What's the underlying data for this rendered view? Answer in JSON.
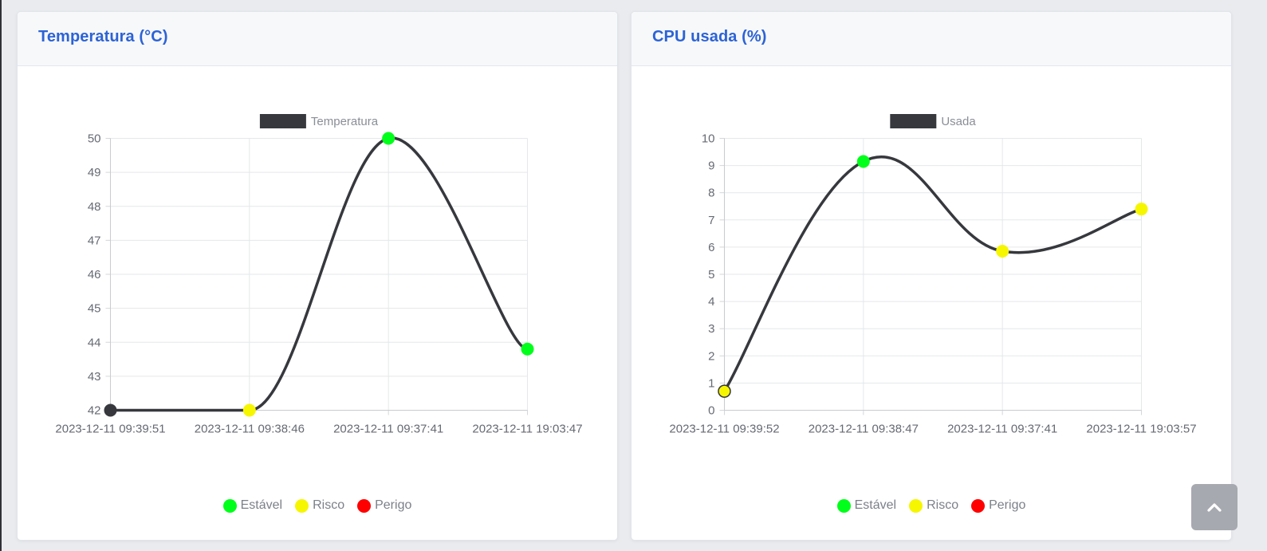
{
  "cards": [
    {
      "title": "Temperatura (°C)"
    },
    {
      "title": "CPU usada (%)"
    }
  ],
  "status_legend": [
    {
      "label": "Estável",
      "color": "#00ff1a"
    },
    {
      "label": "Risco",
      "color": "#f6f600"
    },
    {
      "label": "Perigo",
      "color": "#ff0000"
    }
  ],
  "back_to_top": {
    "icon": "chevron-up-icon"
  },
  "colors": {
    "line": "#36383d",
    "title": "#2c63d6"
  },
  "chart_data": [
    {
      "type": "line",
      "title": "Temperatura (°C)",
      "categories": [
        "2023-12-11 09:39:51",
        "2023-12-11 09:38:46",
        "2023-12-11 09:37:41",
        "2023-12-11 19:03:47"
      ],
      "series": [
        {
          "name": "Temperatura",
          "values": [
            42,
            42,
            50,
            43.8
          ],
          "point_colors": [
            "#36383d",
            "#f6f600",
            "#00ff1a",
            "#00ff1a"
          ]
        }
      ],
      "ylim": [
        42,
        50
      ],
      "yticks": [
        42,
        43,
        44,
        45,
        46,
        47,
        48,
        49,
        50
      ],
      "grid": true,
      "legend": "top-center",
      "curved": false
    },
    {
      "type": "line",
      "title": "CPU usada (%)",
      "categories": [
        "2023-12-11 09:39:52",
        "2023-12-11 09:38:47",
        "2023-12-11 09:37:41",
        "2023-12-11 19:03:57"
      ],
      "series": [
        {
          "name": "Usada",
          "values": [
            0.7,
            9.15,
            5.85,
            7.4
          ],
          "point_colors": [
            "#f6f600",
            "#00ff1a",
            "#f6f600",
            "#f6f600"
          ]
        }
      ],
      "ylim": [
        0,
        10
      ],
      "yticks": [
        0,
        1,
        2,
        3,
        4,
        5,
        6,
        7,
        8,
        9,
        10
      ],
      "grid": true,
      "legend": "top-center",
      "curved": true
    }
  ]
}
